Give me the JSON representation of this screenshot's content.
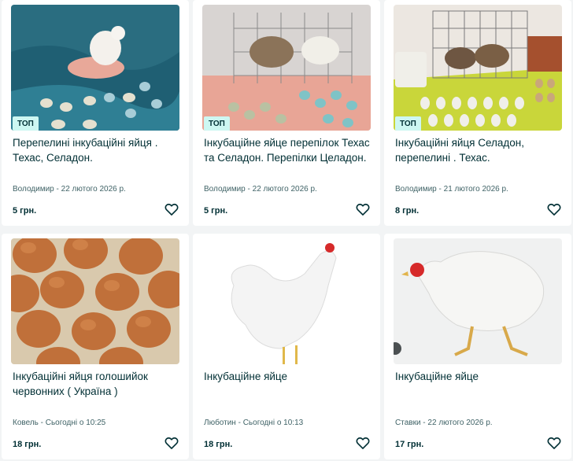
{
  "badge_label": "ТОП",
  "listings": [
    {
      "title": "Перепелині інкубаційні яйця . Техас, Селадон.",
      "meta": "Володимир - 22 лютого 2026 р.",
      "price": "5 грн.",
      "top": true
    },
    {
      "title": "Інкубаційне яйце перепілок Техас та Селадон. Перепілки Целадон.",
      "meta": "Володимир - 22 лютого 2026 р.",
      "price": "5 грн.",
      "top": true
    },
    {
      "title": "Інкубаційні яйця Селадон, перепелині . Техас.",
      "meta": "Володимир - 21 лютого 2026 р.",
      "price": "8 грн.",
      "top": true
    },
    {
      "title": "Інкубаційні яйця голошийок червонних ( Україна )",
      "meta": "Ковель - Сьогодні о 10:25",
      "price": "18 грн.",
      "top": false
    },
    {
      "title": "Інкубаційне яйце",
      "meta": "Люботин - Сьогодні о 10:13",
      "price": "18 грн.",
      "top": false
    },
    {
      "title": "Інкубаційне яйце",
      "meta": "Ставки - 22 лютого 2026 р.",
      "price": "17 грн.",
      "top": false
    }
  ],
  "colors": {
    "badge_bg": "#cdf7f2",
    "text": "#002f34",
    "meta": "#406367"
  },
  "icons": {
    "favorite": "heart-outline-icon"
  }
}
